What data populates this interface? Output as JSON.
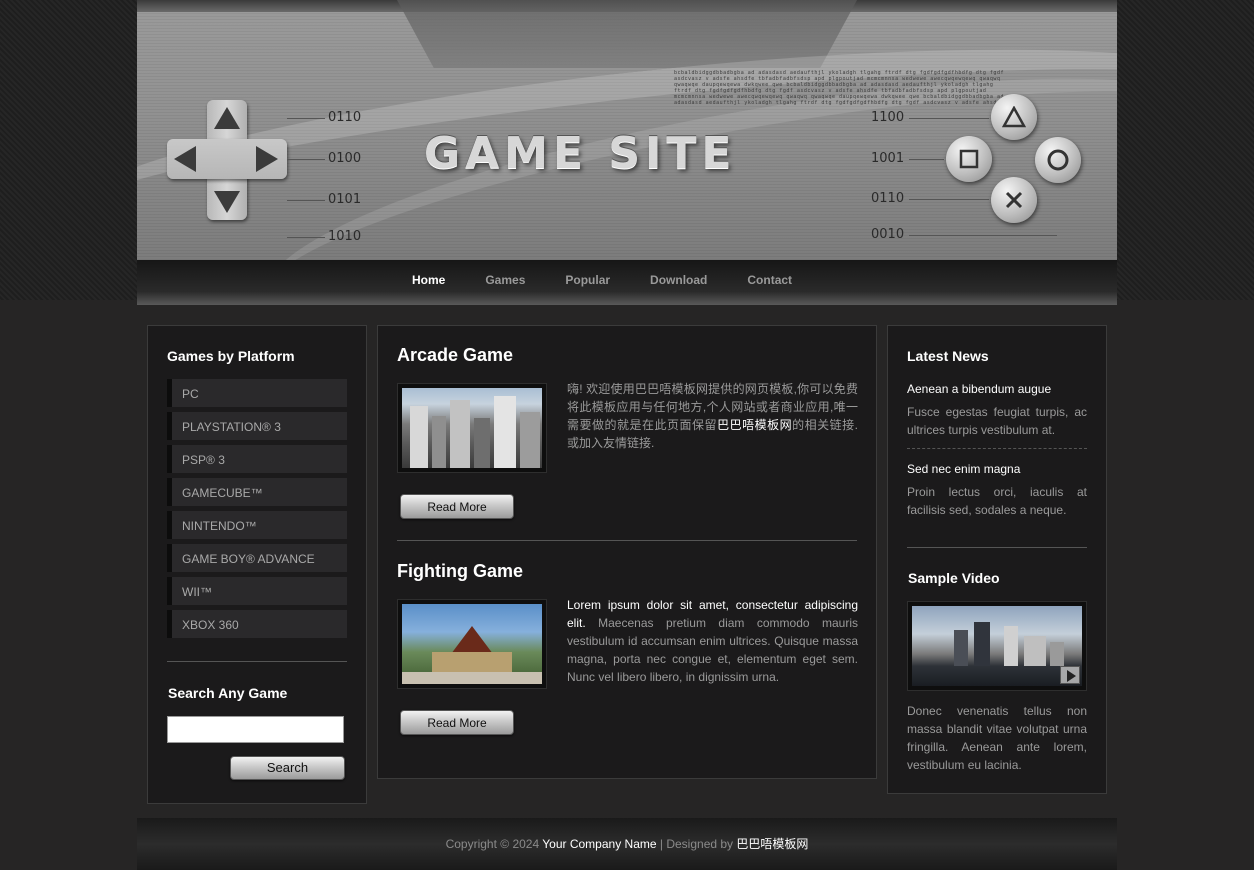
{
  "header": {
    "site_title": "GAME SITE",
    "binary_left": [
      "0110",
      "0100",
      "0101",
      "1010"
    ],
    "binary_right": [
      "1100",
      "1001",
      "0110",
      "0010"
    ],
    "tiny_text": "bcbaldbidggdbbadbgba ad adasdasd aedaufthjl ykoladgh tlgahg ftrdf dtg fgdfgdfgdfhbdfg dtg fgdf asdcvasz v adsfe ahsdfe tbfadbfadbfsdsp apd plgpoutjad mcmcmnnsa wedwewe awecqwqewqewq qwaqwq qwaqwqe daupqewqewa dwkqwee qwe bcbaldbidggdbbadbgba ad adasdasd aedaufthjl ykoladgh tlgahg ftrdf dtg fgdfgdfgdfhbdfg dtg fgdf asdcvasz v adsfe ahsdfe tbfadbfadbfsdsp apd plgpoutjad mcmcmnnsa wedwewe awecqwqewqewq qwaqwq qwaqwqe daupqewqewa dwkqwee qwe bcbaldbidggdbbadbgba ad adasdasd aedaufthjl ykoladgh tlgahg ftrdf dtg fgdfgdfgdfhbdfg dtg fgdf asdcvasz v adsfe ahsdfe"
  },
  "nav": {
    "items": [
      "Home",
      "Games",
      "Popular",
      "Download",
      "Contact"
    ],
    "active": "Home"
  },
  "sidebar": {
    "platform_title": "Games by Platform",
    "platforms": [
      "PC",
      "PLAYSTATION® 3",
      "PSP® 3",
      "GAMECUBE™",
      "NINTENDO™",
      "GAME BOY® ADVANCE",
      "WII™",
      "XBOX 360"
    ],
    "search_title": "Search Any Game",
    "search_value": "",
    "search_button": "Search"
  },
  "main": {
    "posts": [
      {
        "title": "Arcade Game",
        "text_before": "嗨! 欢迎使用巴巴唔模板网提供的网页模板,你可以免费将此模板应用与任何地方,个人网站或者商业应用,唯一需要做的就是在此页面保留",
        "text_highlight": "巴巴唔模板网",
        "text_after": "的相关链接.或加入友情链接.",
        "button": "Read More"
      },
      {
        "title": "Fighting Game",
        "text_highlight": "Lorem ipsum dolor sit amet, consectetur adipiscing elit.",
        "text_after": " Maecenas pretium diam commodo mauris vestibulum id accumsan enim ultrices. Quisque massa magna, porta nec congue et, elementum eget sem. Nunc vel libero libero, in dignissim urna.",
        "button": "Read More"
      }
    ]
  },
  "right": {
    "news_title": "Latest News",
    "news": [
      {
        "title": "Aenean a bibendum augue",
        "body": "Fusce egestas feugiat turpis, ac ultrices turpis vestibulum at."
      },
      {
        "title": "Sed nec enim magna",
        "body": "Proin lectus orci, iaculis at facilisis sed, sodales a neque."
      }
    ],
    "video_title": "Sample Video",
    "video_text": "Donec venenatis tellus non massa blandit vitae volutpat urna fringilla. Aenean ante lorem, vestibulum eu lacinia."
  },
  "footer": {
    "copyright": "Copyright © 2024",
    "company": "Your Company Name",
    "designed_by": "| Designed by",
    "designer": "巴巴唔模板网"
  }
}
